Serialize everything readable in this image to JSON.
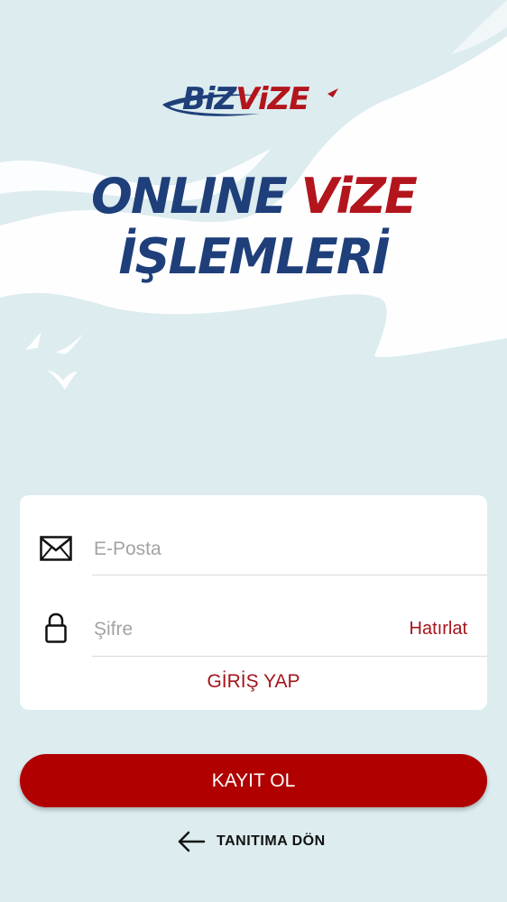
{
  "brand": {
    "logo_part1": "BiZ",
    "logo_part2": "ViZE",
    "navy": "#1f3f7a",
    "red": "#b3151d"
  },
  "headline": {
    "word1": "ONLINE",
    "word2": "ViZE",
    "line2": "İŞLEMLERİ"
  },
  "login_form": {
    "email_icon": "envelope-icon",
    "email_placeholder": "E-Posta",
    "email_value": "",
    "password_icon": "lock-icon",
    "password_placeholder": "Şifre",
    "password_value": "",
    "remind_label": "Hatırlat",
    "login_label": "GİRİŞ YAP"
  },
  "register_label": "KAYIT OL",
  "back": {
    "icon": "arrow-left-icon",
    "label": "TANITIMA DÖN"
  },
  "colors": {
    "background": "#dcecef",
    "button": "#b00000",
    "accent_text": "#a3151d"
  }
}
